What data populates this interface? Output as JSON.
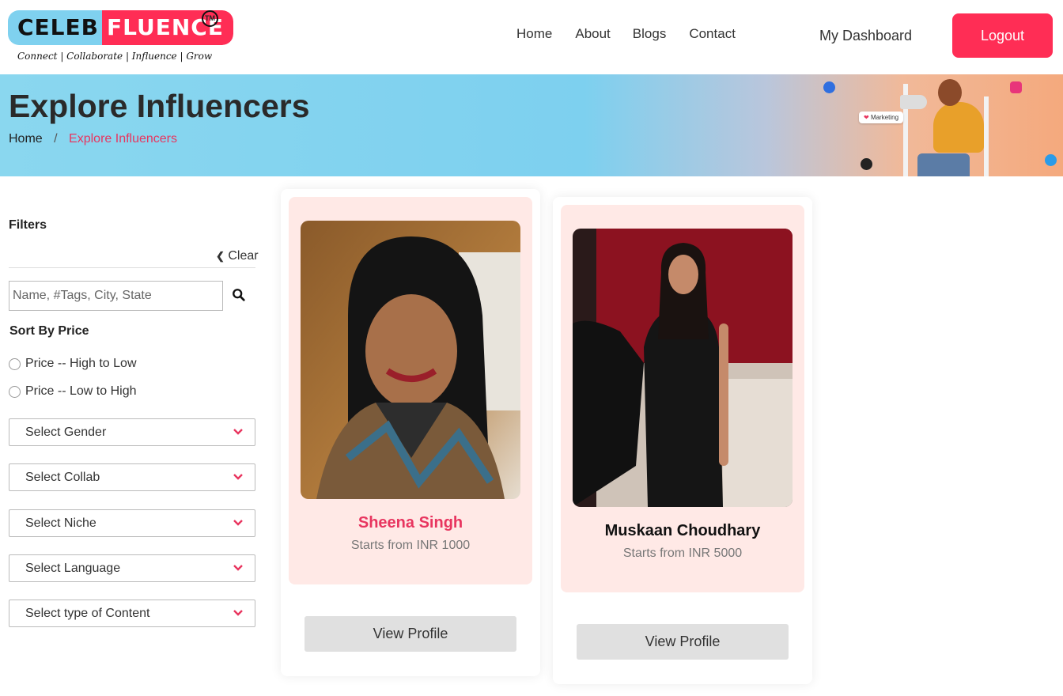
{
  "header": {
    "logo_left": "CELEB",
    "logo_right": "FLUENCE",
    "logo_tm": "TM",
    "tagline": "Connect | Collaborate | Influence | Grow",
    "nav": [
      "Home",
      "About",
      "Blogs",
      "Contact"
    ],
    "dashboard": "My Dashboard",
    "logout": "Logout"
  },
  "banner": {
    "title": "Explore Influencers",
    "breadcrumb_home": "Home",
    "breadcrumb_sep": "/",
    "breadcrumb_current": "Explore Influencers",
    "chip": "Marketing"
  },
  "filters": {
    "title": "Filters",
    "clear": "Clear",
    "search_placeholder": "Name, #Tags, City, State",
    "sort_title": "Sort By Price",
    "sort_options": [
      "Price -- High to Low",
      "Price -- Low to High"
    ],
    "selects": [
      "Select Gender",
      "Select Collab",
      "Select Niche",
      "Select Language",
      "Select type of Content"
    ]
  },
  "cards": [
    {
      "name": "Sheena Singh",
      "price": "Starts from INR 1000",
      "button": "View Profile",
      "name_color": "#e8355f"
    },
    {
      "name": "Muskaan Choudhary",
      "price": "Starts from INR 5000",
      "button": "View Profile",
      "name_color": "#111111"
    }
  ],
  "colors": {
    "accent": "#ff2d55",
    "banner_blue": "#7dd0ef",
    "card_bg": "#ffe9e6"
  }
}
